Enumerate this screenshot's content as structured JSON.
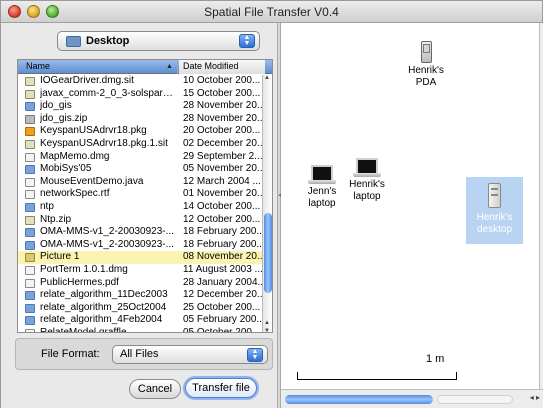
{
  "window": {
    "title": "Spatial File Transfer V0.4"
  },
  "location": {
    "folder": "Desktop"
  },
  "columns": {
    "name": "Name",
    "date": "Date Modified"
  },
  "files": [
    {
      "name": "IOGearDriver.dmg.sit",
      "date": "10 October 200...",
      "icon": "package-icon"
    },
    {
      "name": "javax_comm-2_0_3-solsparc.t...",
      "date": "15 October 200...",
      "icon": "package-icon"
    },
    {
      "name": "jdo_gis",
      "date": "28 November 20...",
      "icon": "folder-icon"
    },
    {
      "name": "jdo_gis.zip",
      "date": "28 November 20...",
      "icon": "zip-icon"
    },
    {
      "name": "KeyspanUSAdrvr18.pkg",
      "date": "20 October 200...",
      "icon": "installer-icon"
    },
    {
      "name": "KeyspanUSAdrvr18.pkg.1.sit",
      "date": "02 December 20...",
      "icon": "package-icon"
    },
    {
      "name": "MapMemo.dmg",
      "date": "29 September 2...",
      "icon": "disk-image-icon"
    },
    {
      "name": "MobiSys'05",
      "date": "05 November 20...",
      "icon": "folder-icon"
    },
    {
      "name": "MouseEventDemo.java",
      "date": "12 March 2004 ...",
      "icon": "document-icon"
    },
    {
      "name": "networkSpec.rtf",
      "date": "01 November 20...",
      "icon": "document-icon"
    },
    {
      "name": "ntp",
      "date": "14 October 200...",
      "icon": "folder-icon"
    },
    {
      "name": "Ntp.zip",
      "date": "12 October 200...",
      "icon": "package-icon"
    },
    {
      "name": "OMA-MMS-v1_2-20030923-...",
      "date": "18 February 200...",
      "icon": "folder-icon"
    },
    {
      "name": "OMA-MMS-v1_2-20030923-...",
      "date": "18 February 200...",
      "icon": "folder-icon"
    },
    {
      "name": "Picture 1",
      "date": "08 November 20...",
      "icon": "picture-icon",
      "selected": true
    },
    {
      "name": "PortTerm 1.0.1.dmg",
      "date": "11 August 2003 ...",
      "icon": "disk-image-icon"
    },
    {
      "name": "PublicHermes.pdf",
      "date": "28 January 2004...",
      "icon": "document-icon"
    },
    {
      "name": "relate_algorithm_11Dec2003",
      "date": "12 December 20...",
      "icon": "folder-icon"
    },
    {
      "name": "relate_algorithm_25Oct2004",
      "date": "25 October 200...",
      "icon": "folder-icon"
    },
    {
      "name": "relate_algorithm_4Feb2004",
      "date": "05 February 200...",
      "icon": "folder-icon"
    },
    {
      "name": "RelateModel.graffle",
      "date": "05 October 200...",
      "icon": "document-icon"
    }
  ],
  "format": {
    "label": "File Format:",
    "value": "All Files"
  },
  "buttons": {
    "cancel": "Cancel",
    "transfer": "Transfer file"
  },
  "devices": {
    "pda": {
      "line1": "Henrik's",
      "line2": "PDA"
    },
    "jenns_laptop": {
      "line1": "Jenn's",
      "line2": "laptop"
    },
    "henriks_laptop": {
      "line1": "Henrik's",
      "line2": "laptop"
    },
    "henriks_desktop": {
      "line1": "Henrik's",
      "line2": "desktop"
    }
  },
  "scale": {
    "label": "1 m"
  },
  "colors": {
    "selection_row": "#fbf3b0",
    "selected_device": "#b9d3f2",
    "accent": "#4d8ee6"
  }
}
